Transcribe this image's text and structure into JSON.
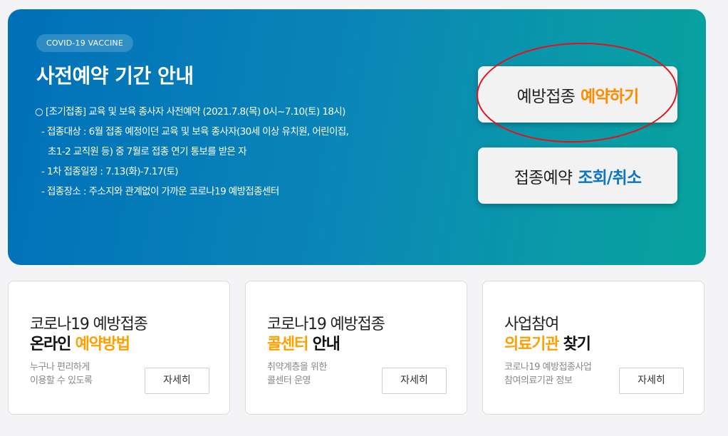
{
  "hero": {
    "badge": "COVID-19 VACCINE",
    "title": "사전예약 기간 안내",
    "notice": {
      "headline": "○ [조기접종] 교육 및 보육 종사자 사전예약 (2021.7.8(목) 0시~7.10(토) 18시)",
      "target": "- 접종대상 : 6월 접종 예정이던 교육 및 보육 종사자(30세 이상 유치원, 어린이집,",
      "target_cont": "초1-2 교직원 등) 중 7월로 접종 연기 통보를 받은 자",
      "schedule": "- 1차 접종일정 : 7.13(화)-7.17(토)",
      "place": "- 접종장소 : 주소지와 관계없이 가까운 코로나19 예방접종센터"
    },
    "reserve_button": {
      "prefix": "예방접종",
      "highlight": "예약하기"
    },
    "lookup_button": {
      "prefix": "접종예약",
      "highlight": "조회/취소"
    }
  },
  "cards": [
    {
      "line1": "코로나19 예방접종",
      "line2_plain": "온라인 ",
      "line2_highlight": "예약방법",
      "desc1": "누구나 편리하게",
      "desc2": "이용할 수 있도록",
      "button": "자세히"
    },
    {
      "line1": "코로나19 예방접종",
      "line2_highlight": "콜센터",
      "line2_plain": " 안내",
      "desc1": "취약계층을 위한",
      "desc2": "콜센터 운영",
      "button": "자세히"
    },
    {
      "line1": "사업참여",
      "line2_highlight": "의료기관",
      "line2_plain": " 찾기",
      "desc1": "코로나19 예방접종사업",
      "desc2": "참여의료기관 정보",
      "button": "자세히"
    }
  ],
  "colors": {
    "hero_gradient_start": "#0070b9",
    "hero_gradient_end": "#08a39d",
    "orange_highlight": "#ff8a00",
    "blue_highlight": "#0b76c4",
    "annotation_ring": "#e2111b"
  }
}
